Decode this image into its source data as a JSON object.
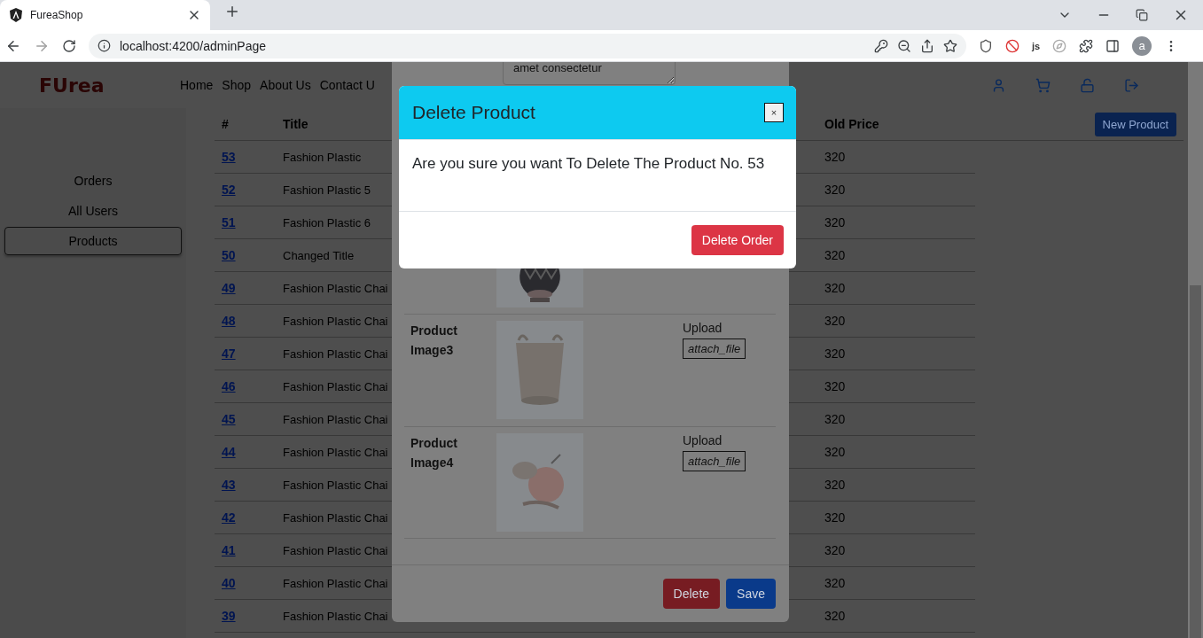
{
  "browser": {
    "tab_title": "FureaShop",
    "url": "localhost:4200/adminPage",
    "js_badge": "js",
    "avatar_letter": "a"
  },
  "navbar": {
    "logo": "FUrea",
    "links": [
      "Home",
      "Shop",
      "About Us",
      "Contact U"
    ]
  },
  "sidebar": {
    "items": [
      {
        "label": "Orders",
        "selected": false
      },
      {
        "label": "All Users",
        "selected": false
      },
      {
        "label": "Products",
        "selected": true
      }
    ]
  },
  "table": {
    "columns": [
      "#",
      "Title",
      "Old Price"
    ],
    "new_button": "New Product",
    "rows": [
      {
        "id": "53",
        "title": "Fashion Plastic",
        "old_price": "320"
      },
      {
        "id": "52",
        "title": "Fashion Plastic 5",
        "old_price": "320"
      },
      {
        "id": "51",
        "title": "Fashion Plastic 6",
        "old_price": "320"
      },
      {
        "id": "50",
        "title": "Changed Title",
        "old_price": "320"
      },
      {
        "id": "49",
        "title": "Fashion Plastic Chai",
        "old_price": "320"
      },
      {
        "id": "48",
        "title": "Fashion Plastic Chai",
        "old_price": "320"
      },
      {
        "id": "47",
        "title": "Fashion Plastic Chai",
        "old_price": "320"
      },
      {
        "id": "46",
        "title": "Fashion Plastic Chai",
        "old_price": "320"
      },
      {
        "id": "45",
        "title": "Fashion Plastic Chai",
        "old_price": "320"
      },
      {
        "id": "44",
        "title": "Fashion Plastic Chai",
        "old_price": "320"
      },
      {
        "id": "43",
        "title": "Fashion Plastic Chai",
        "old_price": "320"
      },
      {
        "id": "42",
        "title": "Fashion Plastic Chai",
        "old_price": "320"
      },
      {
        "id": "41",
        "title": "Fashion Plastic Chai",
        "old_price": "320"
      },
      {
        "id": "40",
        "title": "Fashion Plastic Chai",
        "old_price": "320"
      },
      {
        "id": "39",
        "title": "Fashion Plastic Chai",
        "old_price": "320"
      }
    ]
  },
  "edit_modal": {
    "description_value": "amet consectetur",
    "image_rows": [
      {
        "kind": "picture-only"
      },
      {
        "kind": "upload",
        "label": "Product Image3",
        "upload_label": "Upload",
        "file_button": "attach_file"
      },
      {
        "kind": "upload",
        "label": "Product Image4",
        "upload_label": "Upload",
        "file_button": "attach_file"
      }
    ],
    "buttons": [
      {
        "label": "Delete",
        "kind": "danger"
      },
      {
        "label": "Save",
        "kind": "primary"
      }
    ]
  },
  "delete_dialog": {
    "title": "Delete Product",
    "close": "×",
    "message": "Are you sure you want To Delete The Product No. 53",
    "confirm": "Delete Order"
  }
}
